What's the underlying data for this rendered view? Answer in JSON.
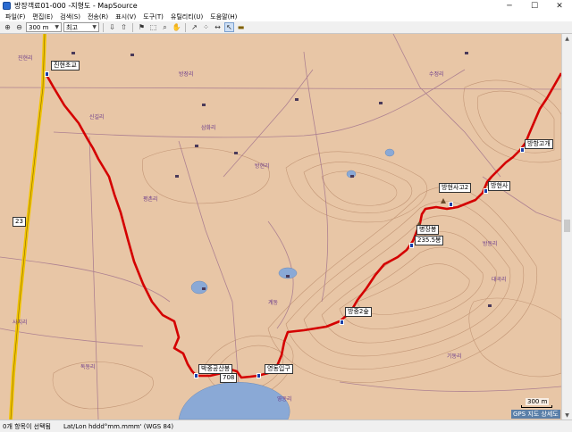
{
  "window": {
    "title": "방장객료01-000 -지형도 - MapSource",
    "minimize": "─",
    "maximize": "☐",
    "close": "✕"
  },
  "menu": [
    "파일(F)",
    "편집(E)",
    "검색(S)",
    "전송(R)",
    "표시(V)",
    "도구(T)",
    "유틸리티(U)",
    "도움말(H)"
  ],
  "toolbar": {
    "zoom_value": "300 m",
    "mode_value": "최고"
  },
  "map": {
    "waypoints": [
      "진현초교",
      "방현사고2",
      "방현사",
      "방항고개",
      "병장봉",
      "235.5봉",
      "방중2숲",
      "박중공산봉",
      "영동입구"
    ],
    "road_numbers": [
      "23",
      "708"
    ],
    "scale": "300 m",
    "gps_note": "GPS 지도 상세도",
    "places": [
      "진현리",
      "방장리",
      "삼화리",
      "방현리",
      "신길리",
      "방동리",
      "사지리",
      "기동리",
      "영동리",
      "독동리",
      "계동",
      "대곡리",
      "수정리",
      "평촌리"
    ]
  },
  "status": {
    "selection": "0개 항목이 선택됨",
    "coords": "Lat/Lon hddd°mm.mmm' (WGS 84)"
  },
  "colors": {
    "map_bg": "#e8c6a6",
    "track": "#d40000",
    "water": "#8aa9d6",
    "contour": "#b98a6a",
    "road": "#9a6a8a"
  }
}
